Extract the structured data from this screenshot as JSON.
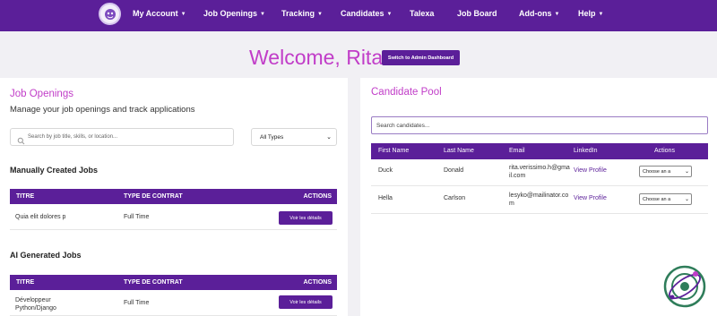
{
  "nav": {
    "items": [
      {
        "label": "My Account",
        "dropdown": true
      },
      {
        "label": "Job Openings",
        "dropdown": true
      },
      {
        "label": "Tracking",
        "dropdown": true
      },
      {
        "label": "Candidates",
        "dropdown": true
      },
      {
        "label": "Talexa",
        "dropdown": false
      },
      {
        "label": "Job Board",
        "dropdown": false
      },
      {
        "label": "Add-ons",
        "dropdown": true
      },
      {
        "label": "Help",
        "dropdown": true
      }
    ],
    "caret": "▼"
  },
  "welcome": {
    "title": "Welcome, Rita!",
    "admin_button": "Switch to Admin Dashboard"
  },
  "jobs": {
    "title": "Job Openings",
    "subtitle": "Manage your job openings and track applications",
    "search_placeholder": "Search by job title, skills, or location...",
    "filter_value": "All Types",
    "manual": {
      "title": "Manually Created Jobs",
      "headers": [
        "TITRE",
        "TYPE DE CONTRAT",
        "ACTIONS"
      ],
      "rows": [
        {
          "title": "Quia elit dolores p",
          "type": "Full Time",
          "action": "Voir les détails"
        }
      ]
    },
    "ai": {
      "title": "AI Generated Jobs",
      "headers": [
        "TITRE",
        "TYPE DE CONTRAT",
        "ACTIONS"
      ],
      "rows": [
        {
          "title_line1": "Développeur",
          "title_line2": "Python/Django",
          "type": "Full Time",
          "action": "Voir les détails"
        }
      ]
    }
  },
  "candidates": {
    "title": "Candidate Pool",
    "search_placeholder": "Search candidates...",
    "headers": [
      "First Name",
      "Last Name",
      "Email",
      "LinkedIn",
      "Actions"
    ],
    "rows": [
      {
        "first": "Duck",
        "last": "Donald",
        "email": "rita.verissimo.h@gmail.com",
        "linkedin": "View Profile",
        "action": "Choose an a"
      },
      {
        "first": "Hella",
        "last": "Carlson",
        "email": "lesyko@mailinator.com",
        "linkedin": "View Profile",
        "action": "Choose an a"
      }
    ]
  },
  "colors": {
    "brand": "#5b1f99",
    "accent": "#c13dc8"
  }
}
